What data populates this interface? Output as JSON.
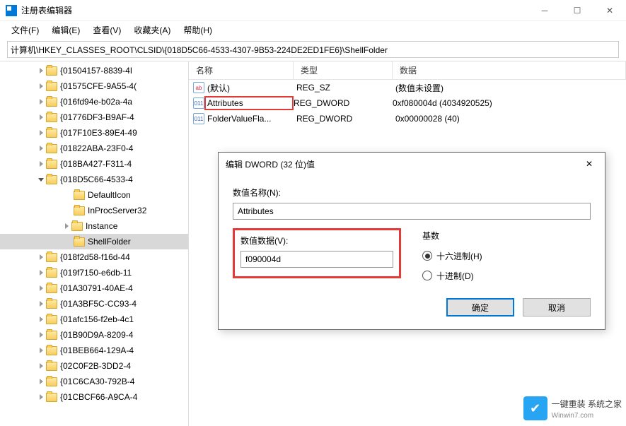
{
  "window": {
    "title": "注册表编辑器"
  },
  "menu": {
    "file": "文件(F)",
    "edit": "编辑(E)",
    "view": "查看(V)",
    "favorites": "收藏夹(A)",
    "help": "帮助(H)"
  },
  "address": {
    "path": "计算机\\HKEY_CLASSES_ROOT\\CLSID\\{018D5C66-4533-4307-9B53-224DE2ED1FE6}\\ShellFolder"
  },
  "tree": {
    "items": [
      {
        "label": "{01504157-8839-4I",
        "expandable": true
      },
      {
        "label": "{01575CFE-9A55-4(",
        "expandable": true
      },
      {
        "label": "{016fd94e-b02a-4a",
        "expandable": true
      },
      {
        "label": "{01776DF3-B9AF-4",
        "expandable": true
      },
      {
        "label": "{017F10E3-89E4-49",
        "expandable": true
      },
      {
        "label": "{01822ABA-23F0-4",
        "expandable": true
      },
      {
        "label": "{018BA427-F311-4",
        "expandable": true
      },
      {
        "label": "{018D5C66-4533-4",
        "expanded": true,
        "children": [
          {
            "label": "DefaultIcon"
          },
          {
            "label": "InProcServer32"
          },
          {
            "label": "Instance",
            "expandable": true
          },
          {
            "label": "ShellFolder",
            "selected": true
          }
        ]
      },
      {
        "label": "{018f2d58-f16d-44",
        "expandable": true
      },
      {
        "label": "{019f7150-e6db-11",
        "expandable": true
      },
      {
        "label": "{01A30791-40AE-4",
        "expandable": true
      },
      {
        "label": "{01A3BF5C-CC93-4",
        "expandable": true
      },
      {
        "label": "{01afc156-f2eb-4c1",
        "expandable": true
      },
      {
        "label": "{01B90D9A-8209-4",
        "expandable": true
      },
      {
        "label": "{01BEB664-129A-4",
        "expandable": true
      },
      {
        "label": "{02C0F2B-3DD2-4",
        "expandable": true
      },
      {
        "label": "{01C6CA30-792B-4",
        "expandable": true
      },
      {
        "label": "{01CBCF66-A9CA-4",
        "expandable": true
      }
    ]
  },
  "list": {
    "headers": {
      "name": "名称",
      "type": "类型",
      "data": "数据"
    },
    "rows": [
      {
        "name": "(默认)",
        "type": "REG_SZ",
        "data": "(数值未设置)",
        "kind": "sz"
      },
      {
        "name": "Attributes",
        "type": "REG_DWORD",
        "data": "0xf080004d (4034920525)",
        "kind": "dword",
        "highlighted": true
      },
      {
        "name": "FolderValueFla...",
        "type": "REG_DWORD",
        "data": "0x00000028 (40)",
        "kind": "dword"
      }
    ]
  },
  "dialog": {
    "title": "编辑 DWORD (32 位)值",
    "value_name_label": "数值名称(N):",
    "value_name": "Attributes",
    "value_data_label": "数值数据(V):",
    "value_data": "f090004d",
    "base_label": "基数",
    "hex_label": "十六进制(H)",
    "dec_label": "十进制(D)",
    "ok": "确定",
    "cancel": "取消"
  },
  "watermark": {
    "brand": "一键重装",
    "sub": "系统之家",
    "url": "Winwin7.com"
  }
}
